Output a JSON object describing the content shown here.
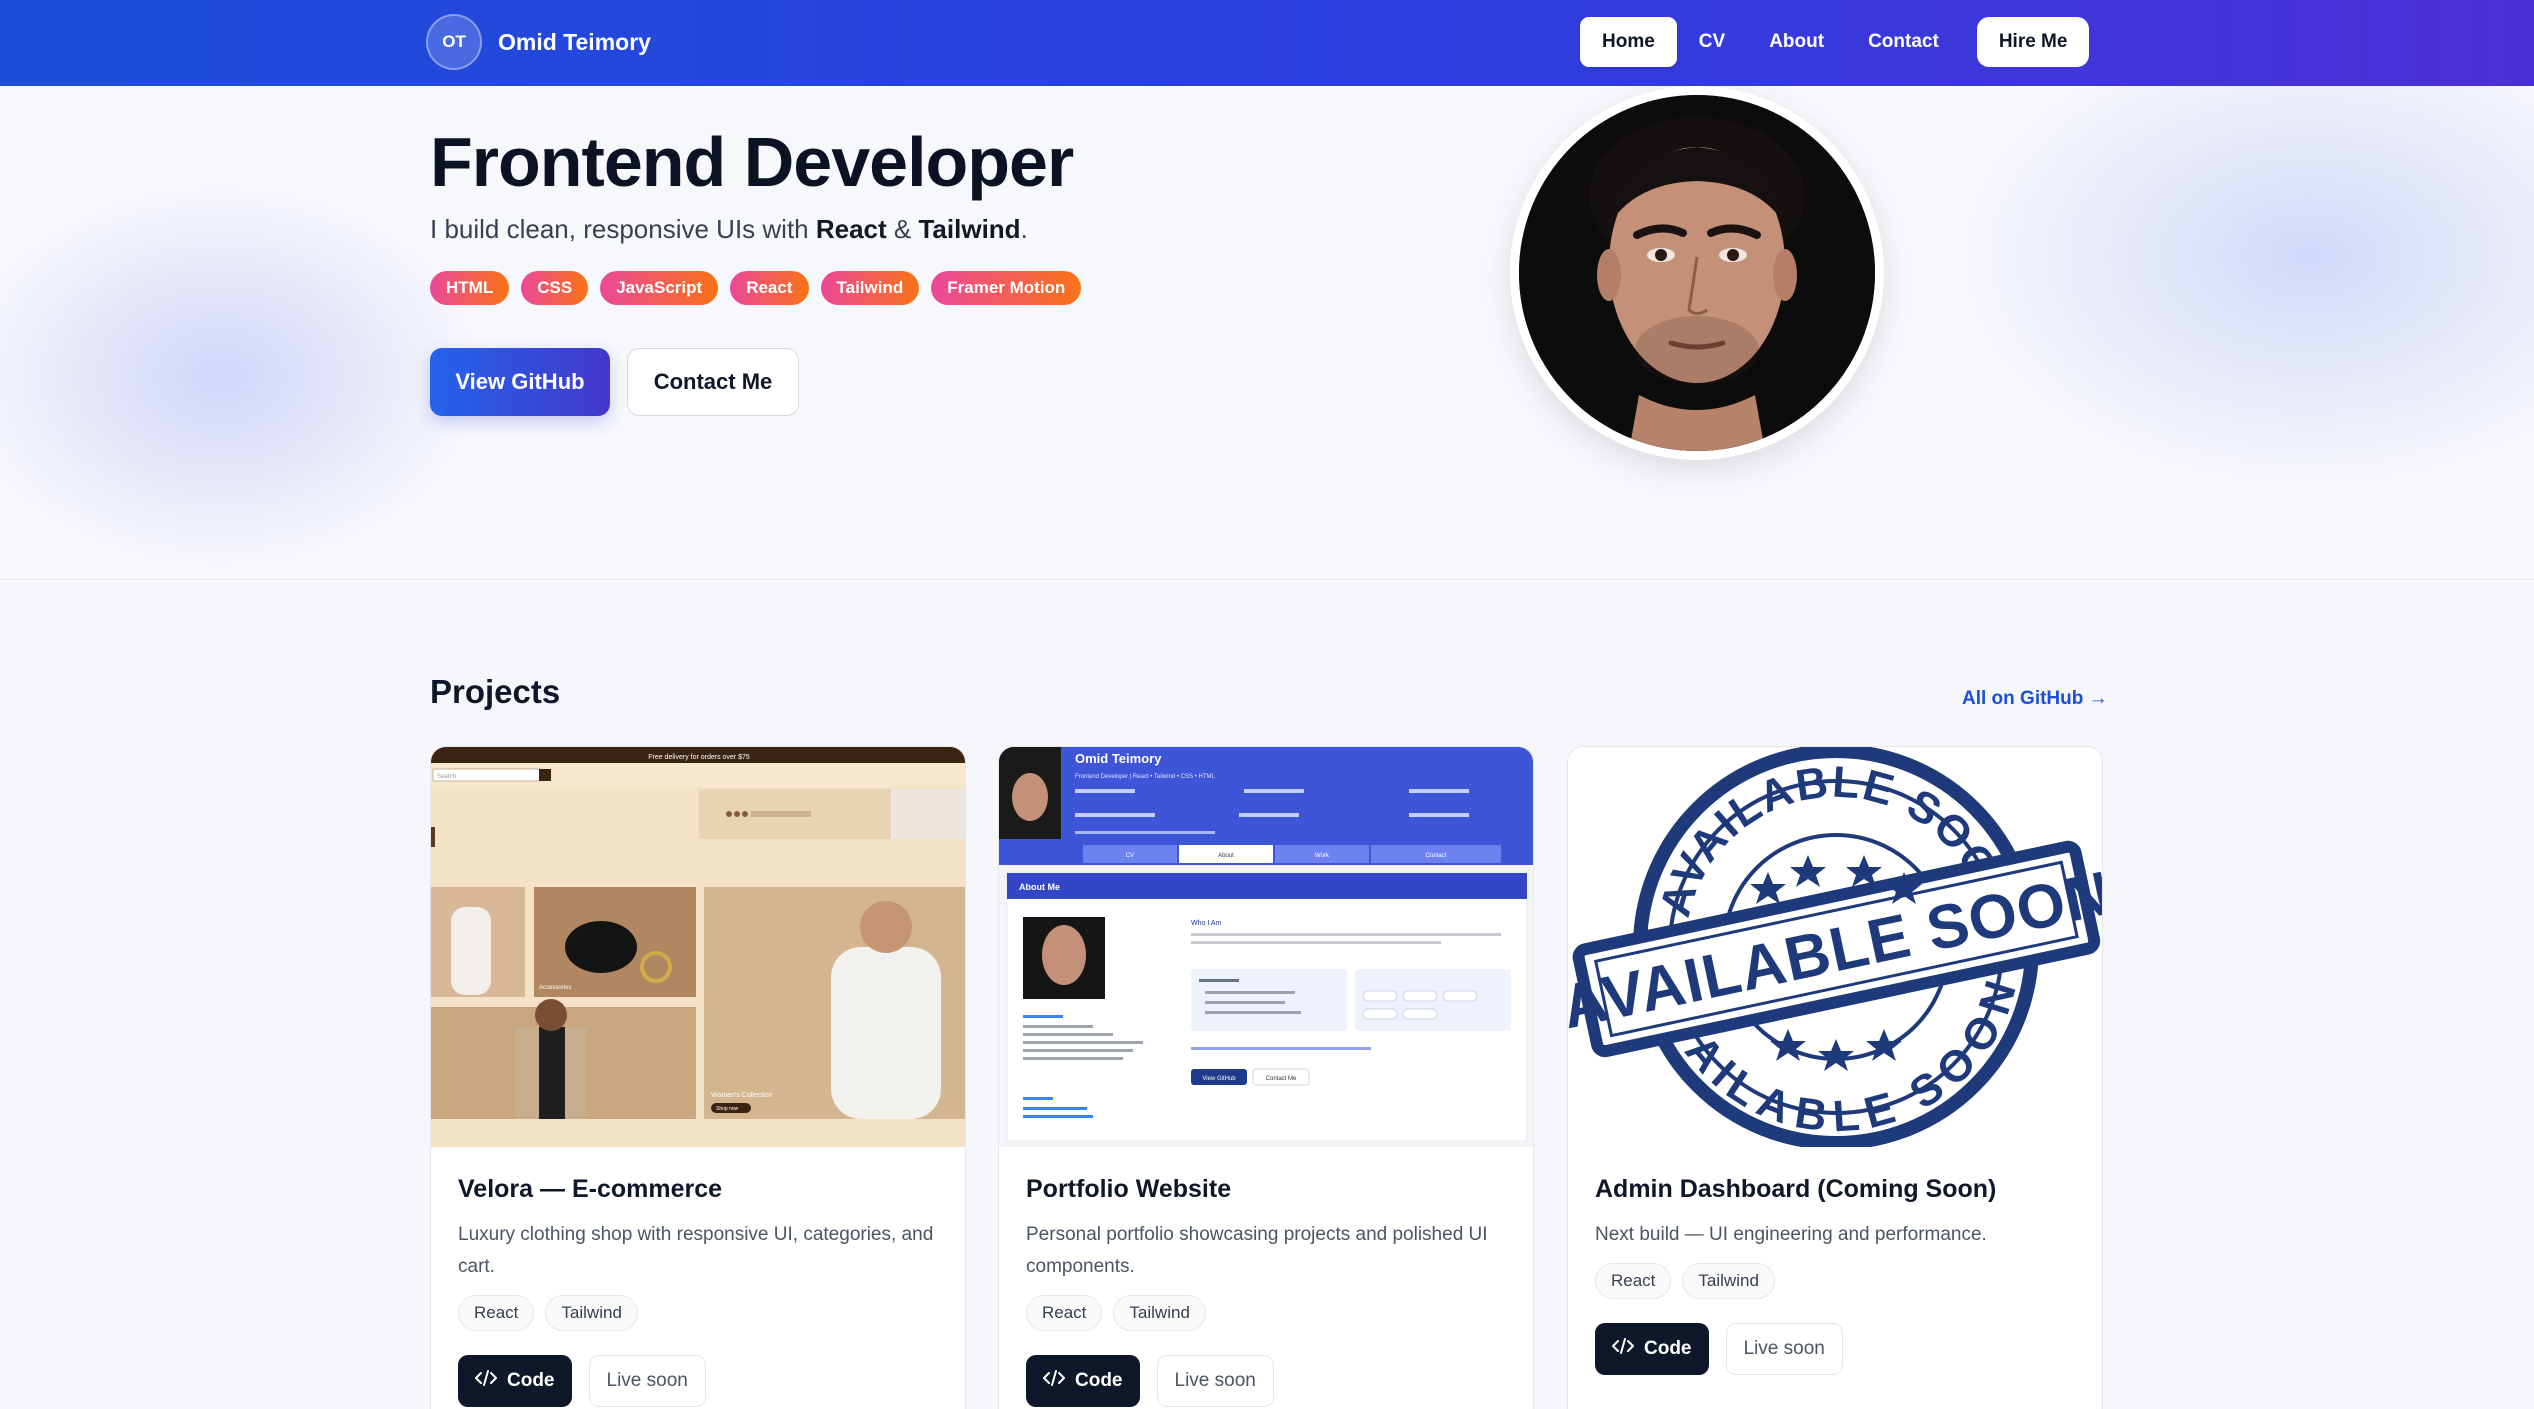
{
  "navbar": {
    "logo_initials": "OT",
    "brand_name": "Omid Teimory",
    "items": [
      {
        "label": "Home",
        "active": true
      },
      {
        "label": "CV",
        "active": false
      },
      {
        "label": "About",
        "active": false
      },
      {
        "label": "Contact",
        "active": false
      }
    ],
    "hire_label": "Hire Me"
  },
  "hero": {
    "title": "Frontend Developer",
    "subtitle_prefix": "I build clean, responsive UIs with ",
    "subtitle_react": "React",
    "subtitle_amp": " & ",
    "subtitle_tailwind": "Tailwind",
    "subtitle_suffix": ".",
    "tags": [
      "HTML",
      "CSS",
      "JavaScript",
      "React",
      "Tailwind",
      "Framer Motion"
    ],
    "primary_button": "View GitHub",
    "secondary_button": "Contact Me"
  },
  "projects": {
    "title": "Projects",
    "all_link": "All on GitHub →",
    "cards": [
      {
        "title": "Velora — E-commerce",
        "description": "Luxury clothing shop with responsive UI, categories, and cart.",
        "tags": [
          "React",
          "Tailwind"
        ],
        "code_label": "Code",
        "live_label": "Live soon"
      },
      {
        "title": "Portfolio Website",
        "description": "Personal portfolio showcasing projects and polished UI components.",
        "tags": [
          "React",
          "Tailwind"
        ],
        "code_label": "Code",
        "live_label": "Live soon"
      },
      {
        "title": "Admin Dashboard (Coming Soon)",
        "description": "Next build — UI engineering and performance.",
        "tags": [
          "React",
          "Tailwind"
        ],
        "code_label": "Code",
        "live_label": "Live soon"
      }
    ]
  },
  "thumbs": {
    "velora_banner": "Free delivery for orders over $75",
    "velora_search": "Search",
    "velora_collection": "Women's Collection",
    "velora_shop": "Shop now",
    "velora_accessories": "Accessories",
    "portfolio_name": "Omid Teimory",
    "portfolio_role": "Frontend Developer | React • Tailwind • CSS • HTML",
    "portfolio_tabs": [
      "CV",
      "About",
      "Work",
      "Contact"
    ],
    "portfolio_about": "About Me",
    "portfolio_who": "Who I Am",
    "portfolio_btn": "View GitHub",
    "portfolio_btn2": "Contact Me",
    "stamp_top": "AVAILABLE SOON",
    "stamp_mid": "AVAILABLE SOON",
    "stamp_bottom": "AVAILABLE SOON"
  },
  "colors": {
    "nav_gradient_start": "#1d4ed8",
    "nav_gradient_end": "#4c2fd4",
    "tag_gradient_start": "#ec4899",
    "tag_gradient_end": "#f97316",
    "link": "#1d4ed8",
    "stamp": "#1f3a7a"
  },
  "icons": {
    "code": "code-brackets-icon"
  }
}
